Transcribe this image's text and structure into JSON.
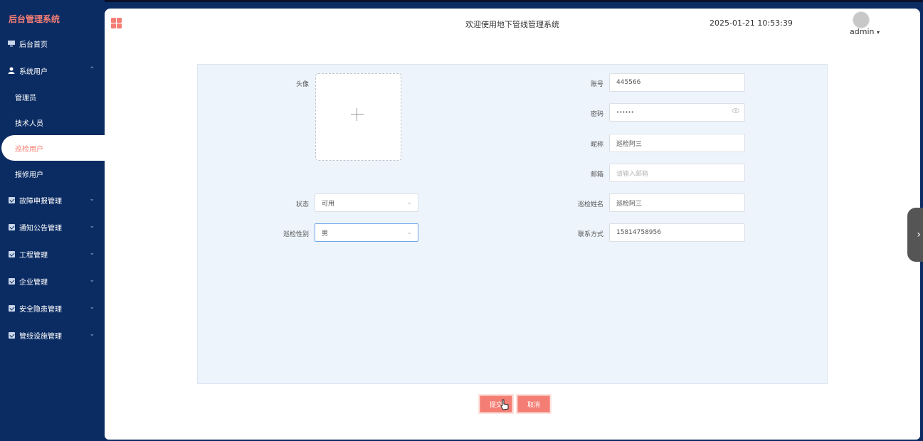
{
  "app": {
    "brand": "后台管理系统"
  },
  "header": {
    "welcome": "欢迎使用地下管线管理系统",
    "datetime": "2025-01-21 10:53:39",
    "user": "admin",
    "user_caret": "▾"
  },
  "sidebar": {
    "items": [
      {
        "label": "后台首页",
        "icon": "monitor-icon"
      },
      {
        "label": "系统用户",
        "icon": "user-icon",
        "chevron": "⌃"
      },
      {
        "label": "管理员"
      },
      {
        "label": "技术人员"
      },
      {
        "label": "巡检用户",
        "active": true
      },
      {
        "label": "报修用户"
      },
      {
        "label": "故障申报管理",
        "icon": "checkbox-icon",
        "chevron": "⌄"
      },
      {
        "label": "通知公告管理",
        "icon": "checkbox-icon",
        "chevron": "⌄"
      },
      {
        "label": "工程管理",
        "icon": "checkbox-icon",
        "chevron": "⌄"
      },
      {
        "label": "企业管理",
        "icon": "checkbox-icon",
        "chevron": "⌄"
      },
      {
        "label": "安全隐患管理",
        "icon": "checkbox-icon",
        "chevron": "⌄"
      },
      {
        "label": "管线设施管理",
        "icon": "checkbox-icon",
        "chevron": "⌄"
      }
    ]
  },
  "form": {
    "avatar_label": "头像",
    "status_label": "状态",
    "status_value": "可用",
    "gender_label": "巡检性别",
    "gender_value": "男",
    "account_label": "账号",
    "account_value": "445566",
    "password_label": "密码",
    "password_value": "••••••",
    "nickname_label": "昵称",
    "nickname_value": "巡检阿三",
    "email_label": "邮箱",
    "email_placeholder": "请输入邮箱",
    "name_label": "巡检姓名",
    "name_value": "巡检阿三",
    "phone_label": "联系方式",
    "phone_value": "15814758956"
  },
  "buttons": {
    "submit": "提交",
    "cancel": "取消"
  },
  "colors": {
    "accent": "#f47e74",
    "sidebar": "#0b2c63",
    "form_bg": "#edf4fb"
  }
}
